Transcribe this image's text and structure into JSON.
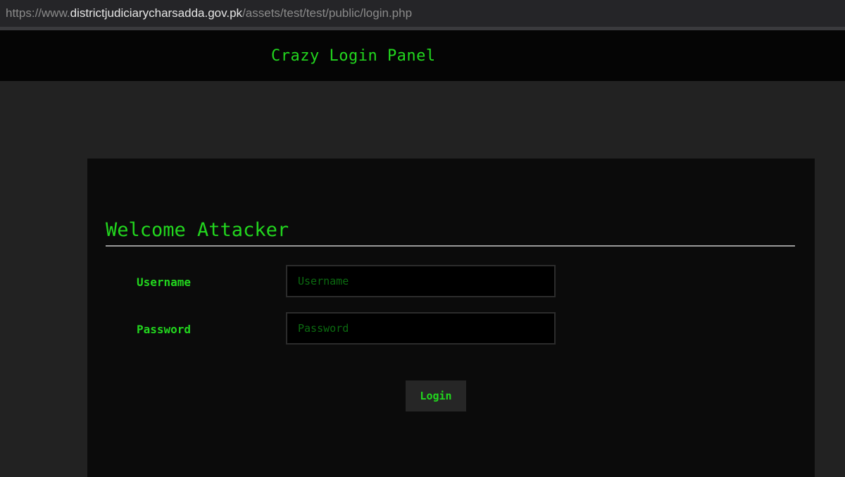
{
  "browser": {
    "url_prefix": "https://www.",
    "url_domain": "districtjudiciarycharsadda.gov.pk",
    "url_path": "/assets/test/test/public/login.php"
  },
  "header": {
    "title": "Crazy Login Panel"
  },
  "panel": {
    "welcome": "Welcome Attacker",
    "username_label": "Username",
    "username_placeholder": "Username",
    "username_value": "",
    "password_label": "Password",
    "password_placeholder": "Password",
    "password_value": "",
    "login_label": "Login"
  },
  "colors": {
    "accent": "#22d61e",
    "page_background": "#222222",
    "panel_background": "#0b0b0b",
    "header_background": "#050505"
  }
}
